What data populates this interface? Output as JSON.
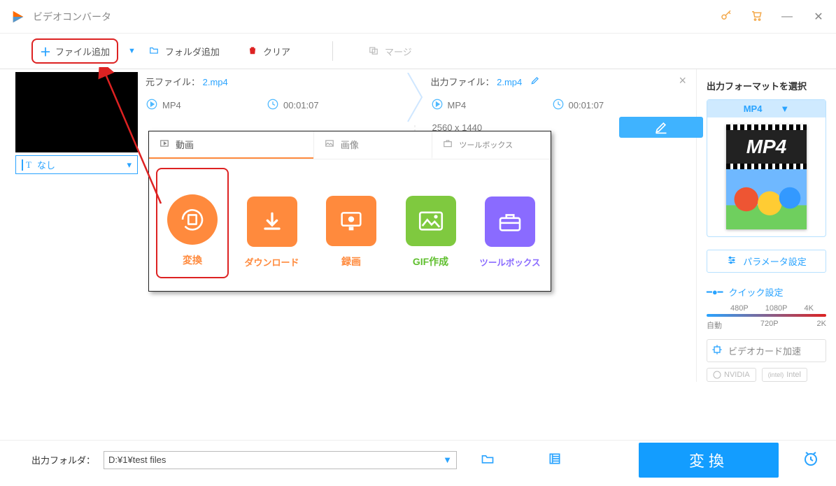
{
  "title": "ビデオコンバータ",
  "toolbar": {
    "add_file": "ファイル追加",
    "add_folder": "フォルダ追加",
    "clear": "クリア",
    "merge": "マージ"
  },
  "subtitle": {
    "label": "なし"
  },
  "source": {
    "label_prefix": "元ファイル：",
    "filename": "2.mp4",
    "format": "MP4",
    "duration": "00:01:07"
  },
  "output": {
    "label_prefix": "出力ファイル：",
    "filename": "2.mp4",
    "format": "MP4",
    "duration": "00:01:07",
    "dimensions": "2560 x 1440"
  },
  "popup": {
    "tab_video": "動画",
    "tab_image": "画像",
    "tab_toolbox": "ツールボックス",
    "cards": {
      "convert": "変換",
      "download": "ダウンロード",
      "record": "録画",
      "gif": "GIF作成",
      "toolbox": "ツールボックス"
    }
  },
  "sidebar": {
    "header": "出力フォーマットを選択",
    "format": "MP4",
    "param_btn": "パラメータ設定",
    "quick": "クイック設定",
    "res": {
      "p480": "480P",
      "p1080": "1080P",
      "k4": "4K",
      "auto": "自動",
      "p720": "720P",
      "k2": "2K"
    },
    "gpu": "ビデオカード加速",
    "nvidia": "NVIDIA",
    "intel": "Intel"
  },
  "bottom": {
    "label": "出力フォルダ：",
    "path": "D:¥1¥test files",
    "convert": "変換"
  }
}
